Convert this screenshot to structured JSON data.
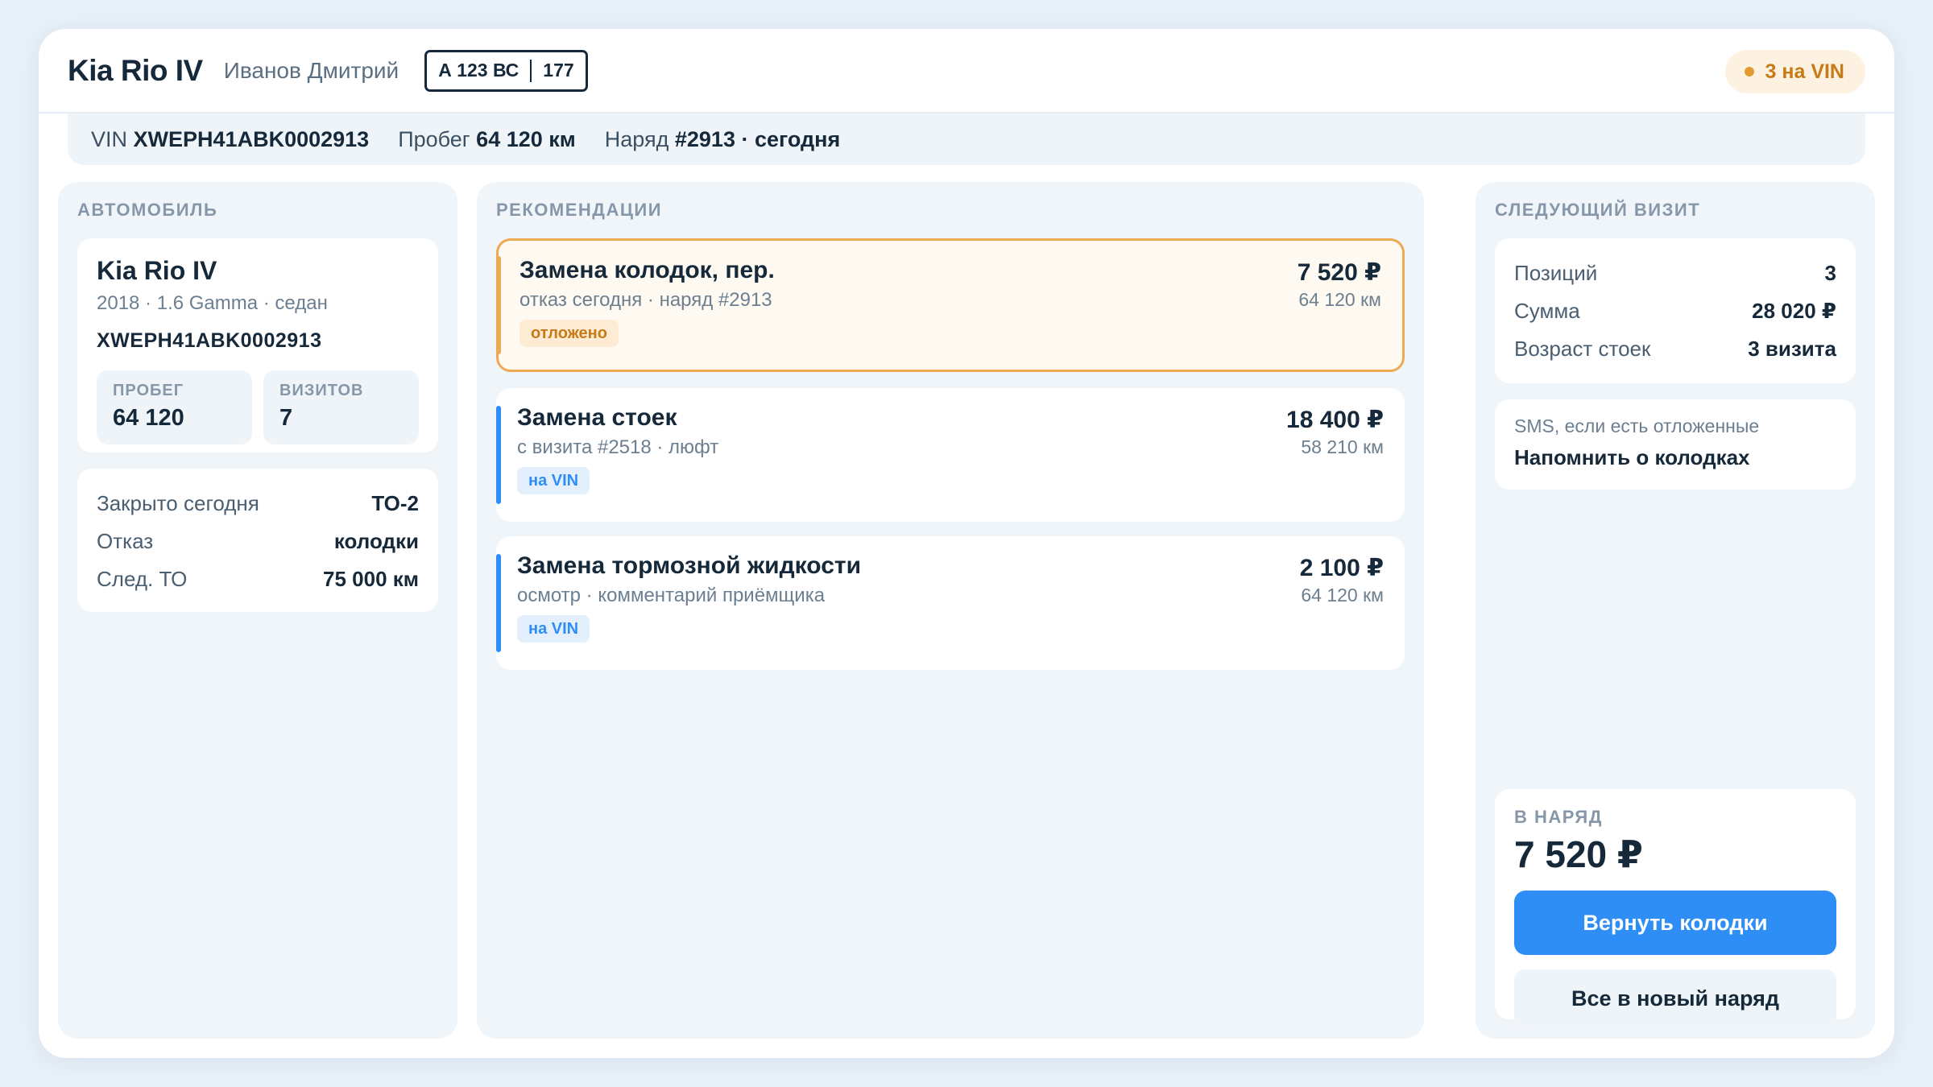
{
  "header": {
    "car_title": "Kia Rio IV",
    "owner": "Иванов Дмитрий",
    "plate_number": "А 123 ВС",
    "plate_region": "177",
    "vin_badge": "3 на VIN"
  },
  "infobar": {
    "vin_label": "VIN",
    "vin_value": "XWEPH41ABK0002913",
    "mileage_label": "Пробег",
    "mileage_value": "64 120 км",
    "order_label": "Наряд",
    "order_value": "#2913 · сегодня"
  },
  "car": {
    "section_label": "АВТОМОБИЛЬ",
    "name": "Kia Rio IV",
    "spec": "2018 · 1.6 Gamma · седан",
    "vin": "XWEPH41ABK0002913",
    "stats": [
      {
        "label": "ПРОБЕГ",
        "value": "64 120"
      },
      {
        "label": "ВИЗИТОВ",
        "value": "7"
      }
    ],
    "facts": [
      {
        "key": "Закрыто сегодня",
        "value": "ТО-2"
      },
      {
        "key": "Отказ",
        "value": "колодки"
      },
      {
        "key": "След. ТО",
        "value": "75 000 км"
      }
    ]
  },
  "recommendations": {
    "section_label": "РЕКОМЕНДАЦИИ",
    "items": [
      {
        "title": "Замена колодок, пер.",
        "sub": "отказ сегодня · наряд #2913",
        "tag": "отложено",
        "price": "7 520 ₽",
        "km": "64 120 км"
      },
      {
        "title": "Замена стоек",
        "sub": "с визита #2518 · люфт",
        "tag": "на VIN",
        "price": "18 400 ₽",
        "km": "58 210 км"
      },
      {
        "title": "Замена тормозной жидкости",
        "sub": "осмотр · комментарий приёмщика",
        "tag": "на VIN",
        "price": "2 100 ₽",
        "km": "64 120 км"
      }
    ]
  },
  "next_visit": {
    "section_label": "СЛЕДУЮЩИЙ ВИЗИТ",
    "summary": [
      {
        "key": "Позиций",
        "value": "3"
      },
      {
        "key": "Сумма",
        "value": "28 020 ₽"
      },
      {
        "key": "Возраст стоек",
        "value": "3 визита"
      }
    ],
    "sms_hint": "SMS, если есть отложенные",
    "sms_action": "Напомнить о колодках",
    "order_label": "В НАРЯД",
    "order_total": "7 520 ₽",
    "primary_button": "Вернуть колодки",
    "secondary_button": "Все в новый наряд"
  },
  "colors": {
    "accent_blue": "#2f8ef5",
    "accent_orange": "#eeaa52",
    "text_dark": "#16293a"
  }
}
